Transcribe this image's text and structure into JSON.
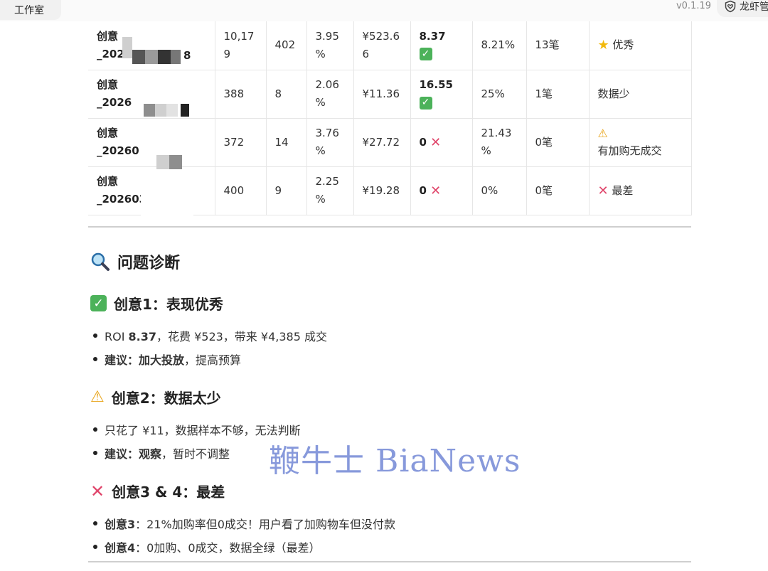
{
  "window": {
    "left_tab": "工作室",
    "version": "v0.1.19",
    "brand": "龙虾管"
  },
  "table_rows": [
    {
      "name_lines": [
        "创意",
        "_202"
      ],
      "name_tail": "8",
      "impressions_lines": [
        "10,17",
        "9"
      ],
      "clicks": "402",
      "ctr_lines": [
        "3.95",
        "%"
      ],
      "spend_lines": [
        "¥523.6",
        "6"
      ],
      "roi": "8.37",
      "roi_mark": "check",
      "cart_rate_lines": [
        "8.21%"
      ],
      "orders": "13笔",
      "verdict": "优秀",
      "verdict_icon": "star-icon"
    },
    {
      "name_lines": [
        "创意",
        "_2026"
      ],
      "name_tail": "",
      "impressions_lines": [
        "388"
      ],
      "clicks": "8",
      "ctr_lines": [
        "2.06",
        "%"
      ],
      "spend_lines": [
        "¥11.36"
      ],
      "roi": "16.55",
      "roi_mark": "check",
      "cart_rate_lines": [
        "25%"
      ],
      "orders": "1笔",
      "verdict": "数据少",
      "verdict_icon": ""
    },
    {
      "name_lines": [
        "创意",
        "_20260"
      ],
      "name_tail": "",
      "impressions_lines": [
        "372"
      ],
      "clicks": "14",
      "ctr_lines": [
        "3.76",
        "%"
      ],
      "spend_lines": [
        "¥27.72"
      ],
      "roi": "0",
      "roi_mark": "cross",
      "cart_rate_lines": [
        "21.43",
        "%"
      ],
      "orders": "0笔",
      "verdict": "有加购无成交",
      "verdict_icon": "warning-icon"
    },
    {
      "name_lines": [
        "创意",
        "_202603"
      ],
      "name_tail": "",
      "impressions_lines": [
        "400"
      ],
      "clicks": "9",
      "ctr_lines": [
        "2.25",
        "%"
      ],
      "spend_lines": [
        "¥19.28"
      ],
      "roi": "0",
      "roi_mark": "cross",
      "cart_rate_lines": [
        "0%"
      ],
      "orders": "0笔",
      "verdict": "最差",
      "verdict_icon": "cross-icon"
    }
  ],
  "diagnosis": {
    "title": "问题诊断",
    "sections": [
      {
        "heading": "创意1：表现优秀",
        "icon": "check-icon",
        "bullets": [
          {
            "bold": "",
            "plain": "ROI ",
            "bold2": "8.37",
            "rest": "，花费 ¥523，带来 ¥4,385 成交"
          },
          {
            "bold": "建议：加大投放",
            "plain": "，提高预算",
            "bold2": "",
            "rest": ""
          }
        ]
      },
      {
        "heading": "创意2：数据太少",
        "icon": "warning-icon",
        "bullets": [
          {
            "bold": "",
            "plain": "只花了 ¥11，数据样本不够，无法判断",
            "bold2": "",
            "rest": ""
          },
          {
            "bold": "建议：观察",
            "plain": "，暂时不调整",
            "bold2": "",
            "rest": ""
          }
        ]
      },
      {
        "heading": "创意3 & 4：最差",
        "icon": "cross-icon",
        "bullets": [
          {
            "bold": "创意3",
            "plain": "：21%加购率但0成交！用户看了加购物车但没付款",
            "bold2": "",
            "rest": ""
          },
          {
            "bold": "创意4",
            "plain": "：0加购、0成交，数据全绿（最差）",
            "bold2": "",
            "rest": ""
          }
        ]
      }
    ]
  },
  "watermark": "鞭牛士 BiaNews",
  "colors": {
    "check_green": "#4cb25a",
    "cross_pink": "#e0466b",
    "warn_yellow": "#e8a317",
    "watermark_blue": "#7b8fd8"
  }
}
